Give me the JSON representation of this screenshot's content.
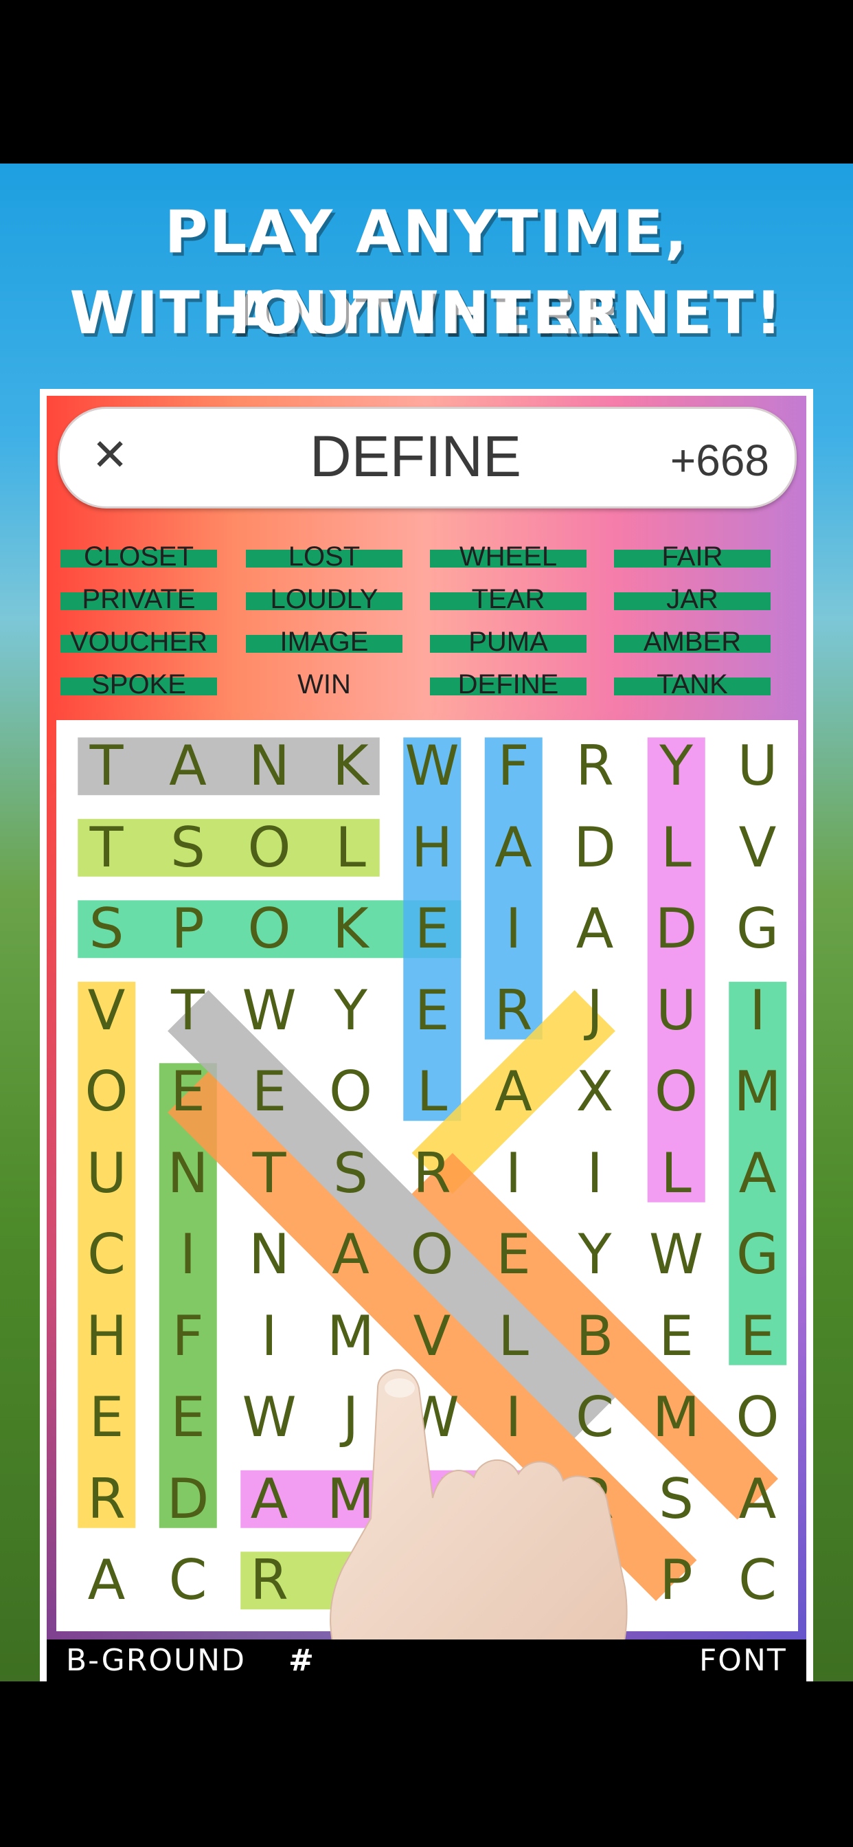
{
  "headline": {
    "line1": "PLAY ANYTIME, ANYWHERE",
    "line2": "WITHOUT INTERNET!"
  },
  "title_bar": {
    "close_icon": "close-icon",
    "current_word": "DEFINE",
    "score": "+668"
  },
  "word_list": [
    "CLOSET",
    "LOST",
    "WHEEL",
    "FAIR",
    "PRIVATE",
    "LOUDLY",
    "TEAR",
    "JAR",
    "VOUCHER",
    "IMAGE",
    "PUMA",
    "AMBER",
    "SPOKE",
    "WIN",
    "DEFINE",
    "TANK"
  ],
  "word_found": [
    true,
    true,
    true,
    true,
    true,
    true,
    true,
    true,
    true,
    true,
    true,
    true,
    true,
    false,
    true,
    true
  ],
  "grid": [
    "TANKWFRYU",
    "TSOLHADLV",
    "SPOKEIADG",
    "VTWYERJUI",
    "OEEOLAXOM",
    "UNTSRIILA",
    "CINAOEYWG",
    "HFIMVLBEE",
    "EEWJWICMO",
    "RDAMUJRSA",
    "ACRAFIIPC"
  ],
  "bottom_bar": {
    "background_label": "B-GROUND",
    "hash_label": "#",
    "font_label": "FONT"
  },
  "colors": {
    "letter": "#4e5f17",
    "found_bar": "#139e63",
    "highlight_gray": "#b4b4b4",
    "highlight_lime": "#bde05a",
    "highlight_teal": "#4fd89a",
    "highlight_blue": "#4fb4f4",
    "highlight_pink": "#f08cf0",
    "highlight_yellow": "#ffd84a",
    "highlight_orange": "#ff9a4a",
    "highlight_green": "#6cc04a"
  }
}
